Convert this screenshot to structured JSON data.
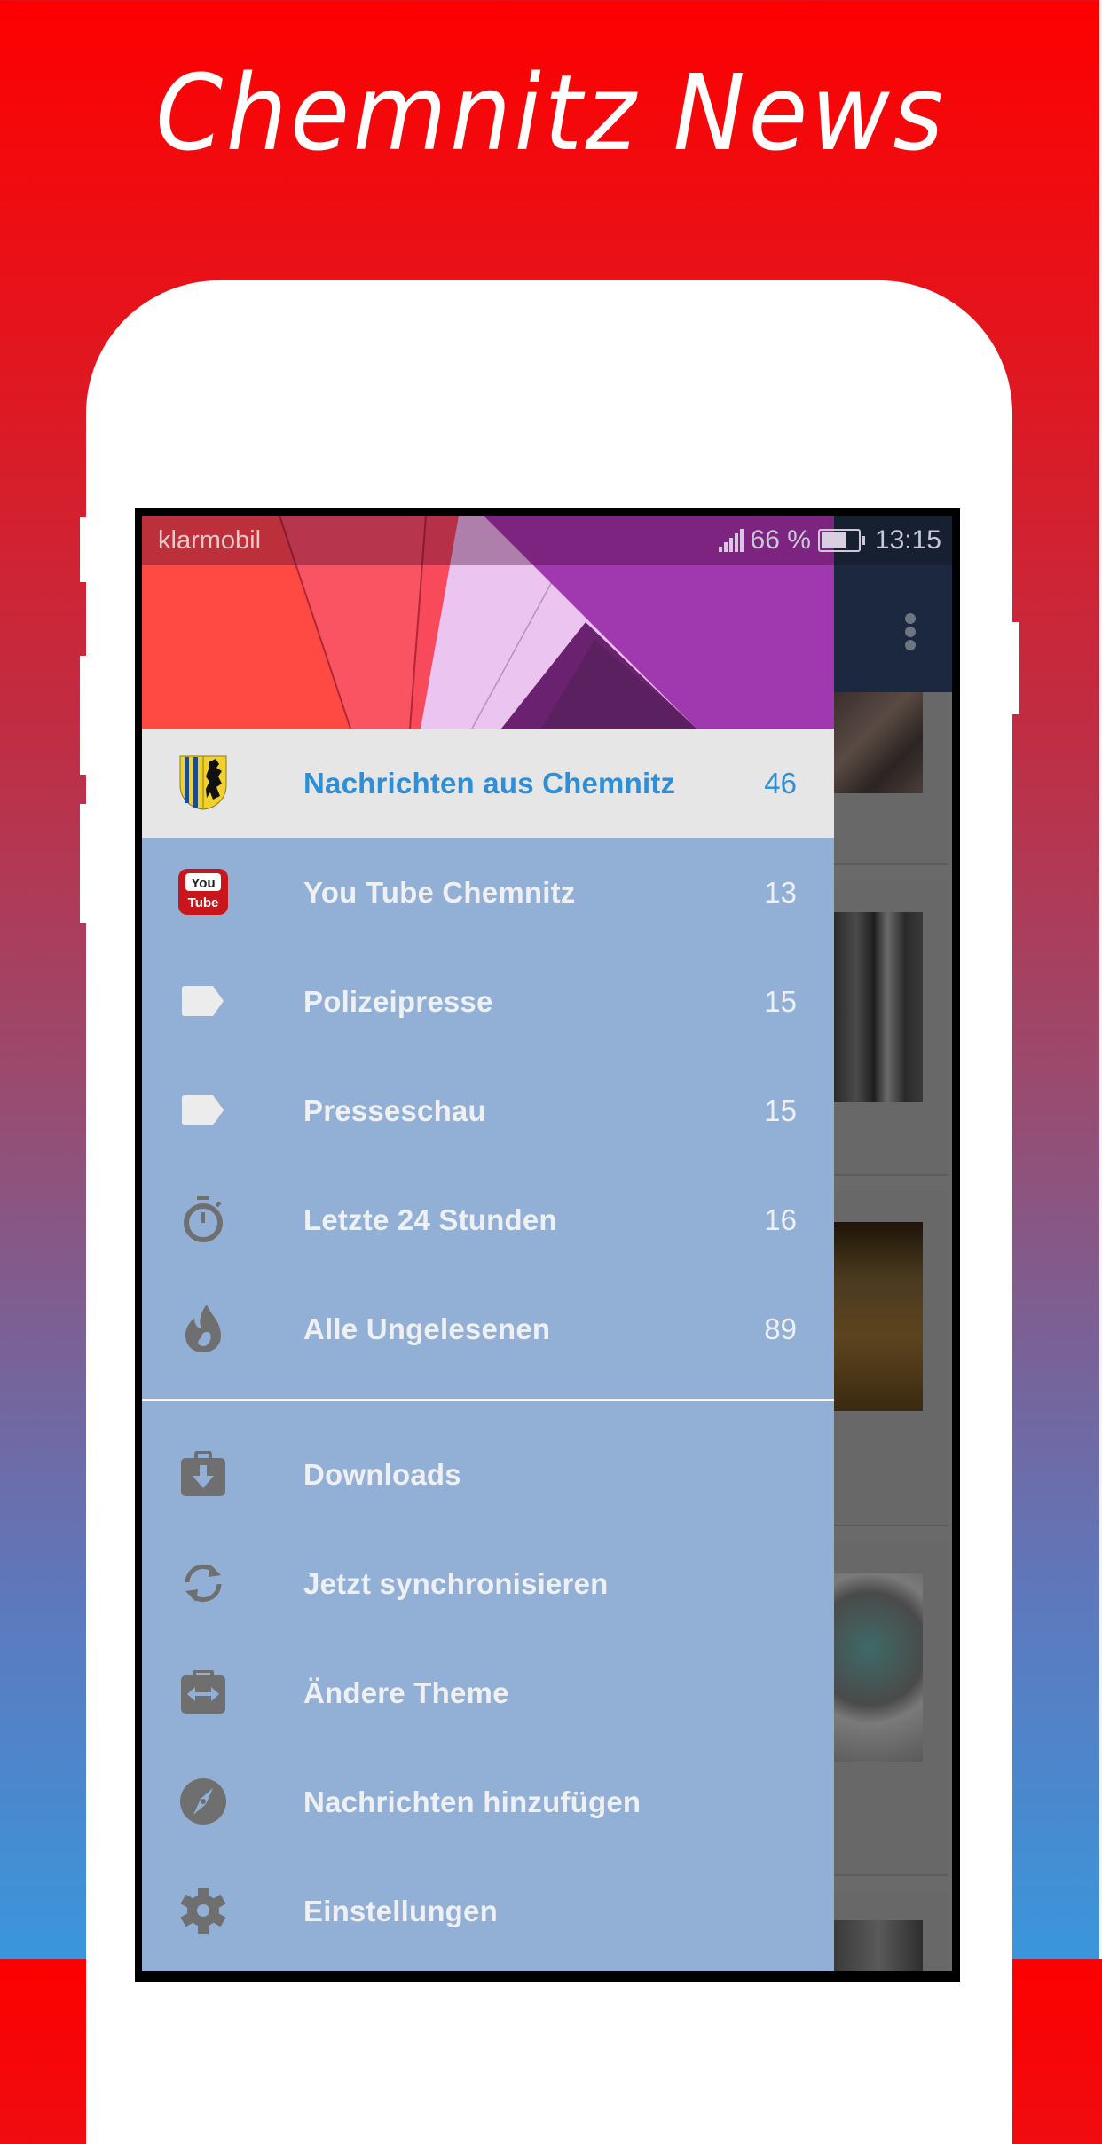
{
  "promo": {
    "title": "Chemnitz News"
  },
  "status_bar": {
    "carrier": "klarmobil",
    "battery_percent_label": "66 %",
    "time": "13:15"
  },
  "drawer": {
    "primary_items": [
      {
        "label": "Nachrichten aus Chemnitz",
        "count": "46",
        "icon": "chemnitz-coat-of-arms-icon",
        "selected": true
      },
      {
        "label": "You Tube Chemnitz",
        "count": "13",
        "icon": "youtube-icon",
        "selected": false
      },
      {
        "label": "Polizeipresse",
        "count": "15",
        "icon": "label-tag-icon",
        "selected": false
      },
      {
        "label": "Presseschau",
        "count": "15",
        "icon": "label-tag-icon",
        "selected": false
      },
      {
        "label": "Letzte 24 Stunden",
        "count": "16",
        "icon": "stopwatch-icon",
        "selected": false
      },
      {
        "label": "Alle Ungelesenen",
        "count": "89",
        "icon": "flame-icon",
        "selected": false
      }
    ],
    "secondary_items": [
      {
        "label": "Downloads",
        "icon": "download-bag-icon"
      },
      {
        "label": "Jetzt synchronisieren",
        "icon": "sync-icon"
      },
      {
        "label": "Ändere Theme",
        "icon": "swap-theme-icon"
      },
      {
        "label": "Nachrichten hinzufügen",
        "icon": "compass-icon"
      },
      {
        "label": "Einstellungen",
        "icon": "gear-icon"
      }
    ]
  },
  "colors": {
    "accent": "#2d8fd8",
    "drawer_bg": "#92b0d6",
    "selected_row_bg": "#e6e6e6",
    "app_bar": "#1b2840",
    "background_top": "#fe0000",
    "background_bottom": "#3a96dc"
  }
}
